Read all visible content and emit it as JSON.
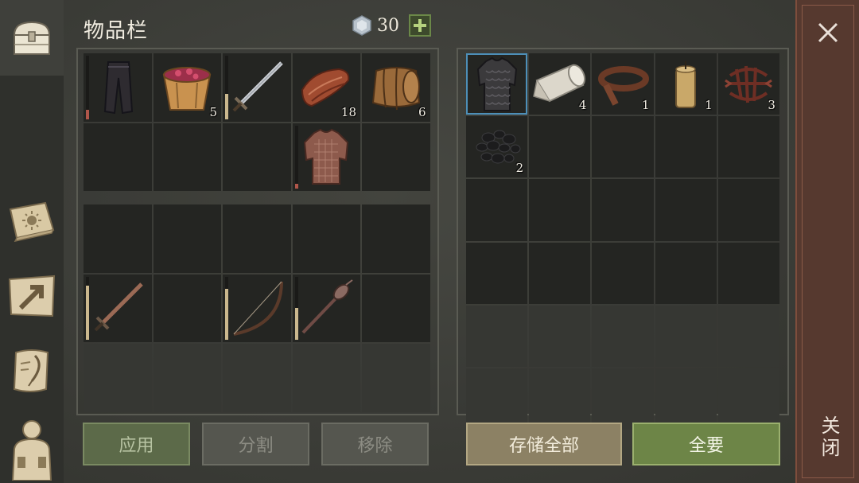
{
  "header": {
    "title": "物品栏",
    "currency_icon": "silver-coin-icon",
    "currency_value": "30",
    "add_icon": "plus-icon"
  },
  "sidebar": {
    "tabs": [
      {
        "icon": "chest-icon",
        "active": true
      },
      {
        "icon": "sun-book-icon",
        "active": false
      },
      {
        "icon": "map-arrow-icon",
        "active": false
      },
      {
        "icon": "quest-scroll-icon",
        "active": false
      },
      {
        "icon": "character-icon",
        "active": false
      }
    ]
  },
  "inventory": {
    "equipped": [
      {
        "icon": "leather-pants-icon",
        "durability": 0.15
      },
      {
        "icon": "berry-bucket-icon",
        "qty": "5"
      },
      {
        "icon": "sword-icon",
        "durability": 0.4
      },
      {
        "icon": "raw-meat-icon",
        "qty": "18"
      },
      {
        "icon": "barrel-icon",
        "qty": "6"
      },
      {},
      {},
      {},
      {
        "icon": "chainmail-icon",
        "durability": 0.08
      },
      {}
    ],
    "bag": [
      {},
      {},
      {},
      {},
      {},
      {
        "icon": "long-sword-icon",
        "durability": 0.85
      },
      {},
      {
        "icon": "bow-icon",
        "durability": 0.8
      },
      {
        "icon": "mace-icon",
        "durability": 0.5
      },
      {},
      {},
      {},
      {},
      {},
      {}
    ]
  },
  "storage": {
    "items": [
      {
        "icon": "scale-armor-icon",
        "selected": true
      },
      {
        "icon": "cloth-roll-icon",
        "qty": "4"
      },
      {
        "icon": "leather-strip-icon",
        "qty": "1"
      },
      {
        "icon": "candle-icon",
        "qty": "1"
      },
      {
        "icon": "rope-knot-icon",
        "qty": "3"
      },
      {
        "icon": "coal-icon",
        "qty": "2"
      }
    ]
  },
  "buttons": {
    "apply": "应用",
    "split": "分割",
    "remove": "移除",
    "store_all": "存储全部",
    "take_all": "全要"
  },
  "close": {
    "icon": "close-icon",
    "label": "关闭"
  },
  "colors": {
    "durability_low": "#b0564a",
    "durability_ok": "#cbb88e",
    "selected": "#4d8fb8",
    "take_all": "#6d8547",
    "close_bg": "#56392f"
  }
}
